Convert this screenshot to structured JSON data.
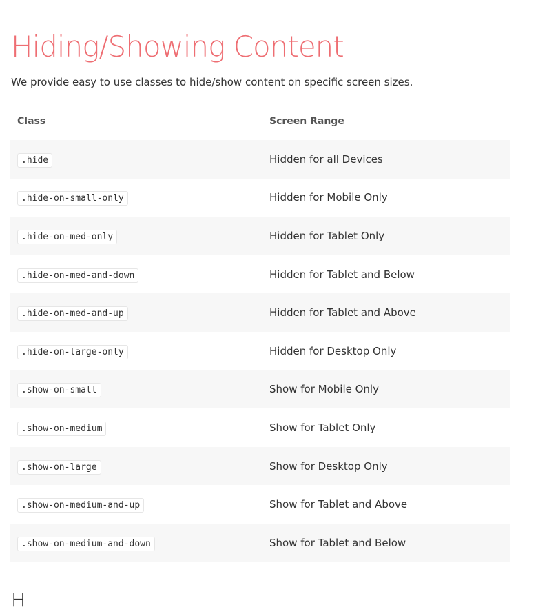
{
  "section": {
    "title": "Hiding/Showing Content",
    "intro": "We provide easy to use classes to hide/show content on specific screen sizes.",
    "title_color": "#ee6e73",
    "next_heading": "H"
  },
  "table": {
    "headers": [
      "Class",
      "Screen Range"
    ],
    "rows": [
      {
        "class": ".hide",
        "range": "Hidden for all Devices"
      },
      {
        "class": ".hide-on-small-only",
        "range": "Hidden for Mobile Only"
      },
      {
        "class": ".hide-on-med-only",
        "range": "Hidden for Tablet Only"
      },
      {
        "class": ".hide-on-med-and-down",
        "range": "Hidden for Tablet and Below"
      },
      {
        "class": ".hide-on-med-and-up",
        "range": "Hidden for Tablet and Above"
      },
      {
        "class": ".hide-on-large-only",
        "range": "Hidden for Desktop Only"
      },
      {
        "class": ".show-on-small",
        "range": "Show for Mobile Only"
      },
      {
        "class": ".show-on-medium",
        "range": "Show for Tablet Only"
      },
      {
        "class": ".show-on-large",
        "range": "Show for Desktop Only"
      },
      {
        "class": ".show-on-medium-and-up",
        "range": "Show for Tablet and Above"
      },
      {
        "class": ".show-on-medium-and-down",
        "range": "Show for Tablet and Below"
      }
    ]
  }
}
